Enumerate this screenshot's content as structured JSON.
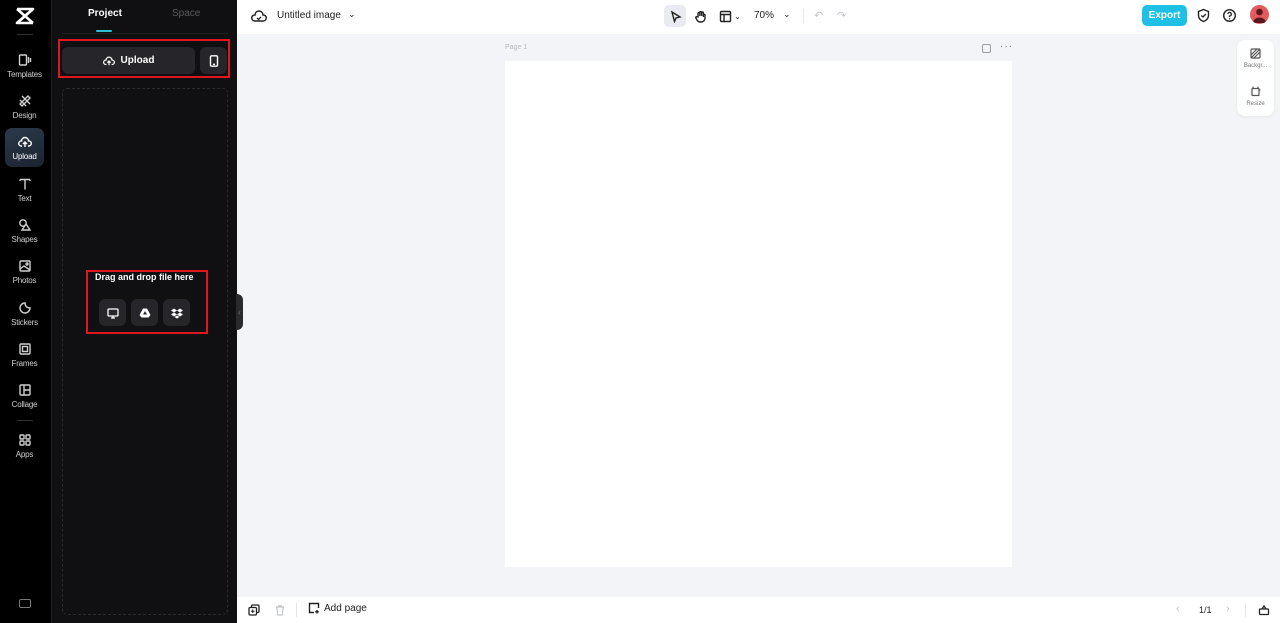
{
  "rail": {
    "items": [
      {
        "label": "Templates",
        "icon": "templates-icon"
      },
      {
        "label": "Design",
        "icon": "design-icon"
      },
      {
        "label": "Upload",
        "icon": "upload-icon",
        "active": true
      },
      {
        "label": "Text",
        "icon": "text-icon"
      },
      {
        "label": "Shapes",
        "icon": "shapes-icon"
      },
      {
        "label": "Photos",
        "icon": "photos-icon"
      },
      {
        "label": "Stickers",
        "icon": "stickers-icon"
      },
      {
        "label": "Frames",
        "icon": "frames-icon"
      },
      {
        "label": "Collage",
        "icon": "collage-icon"
      },
      {
        "label": "Apps",
        "icon": "apps-icon"
      }
    ]
  },
  "panel": {
    "tabs": [
      {
        "label": "Project",
        "active": true
      },
      {
        "label": "Space",
        "active": false
      }
    ],
    "upload_label": "Upload",
    "dropzone_text": "Drag and drop file here",
    "sources": [
      "computer-icon",
      "google-drive-icon",
      "dropbox-icon"
    ]
  },
  "topbar": {
    "doc_title": "Untitled image",
    "zoom": "70%",
    "export_label": "Export"
  },
  "canvas": {
    "page_label": "Page 1"
  },
  "side_float": {
    "items": [
      {
        "label": "Backgr..."
      },
      {
        "label": "Resize"
      }
    ]
  },
  "bottombar": {
    "add_page_label": "Add page",
    "page_count": "1/1"
  },
  "colors": {
    "accent": "#1fc0e6",
    "tab_indicator": "#2bc1d8",
    "highlight": "#e0161e",
    "rail_bg": "#000000",
    "panel_bg": "#101012",
    "canvas_bg": "#f2f4f7"
  }
}
